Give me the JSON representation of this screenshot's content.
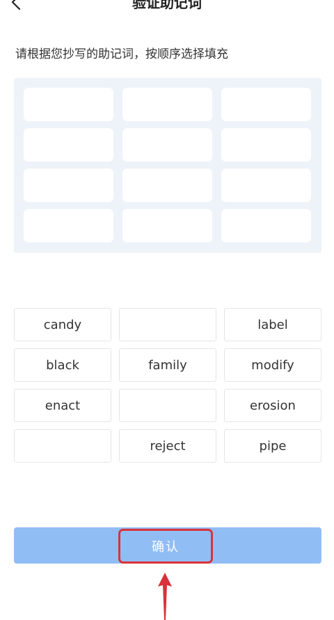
{
  "header": {
    "title": "验证助记词"
  },
  "instruction": "请根据您抄写的助记词，按顺序选择填充",
  "slots": [
    "",
    "",
    "",
    "",
    "",
    "",
    "",
    "",
    "",
    "",
    "",
    ""
  ],
  "words": [
    "candy",
    "",
    "label",
    "black",
    "family",
    "modify",
    "enact",
    "",
    "erosion",
    "",
    "reject",
    "pipe"
  ],
  "confirm": {
    "label": "确认"
  },
  "colors": {
    "button": "#91bdf5",
    "panel": "#eef3f9",
    "highlight": "#d9323a"
  },
  "icons": {
    "back": "chevron-left-icon",
    "annotation": "arrow-up-icon"
  }
}
